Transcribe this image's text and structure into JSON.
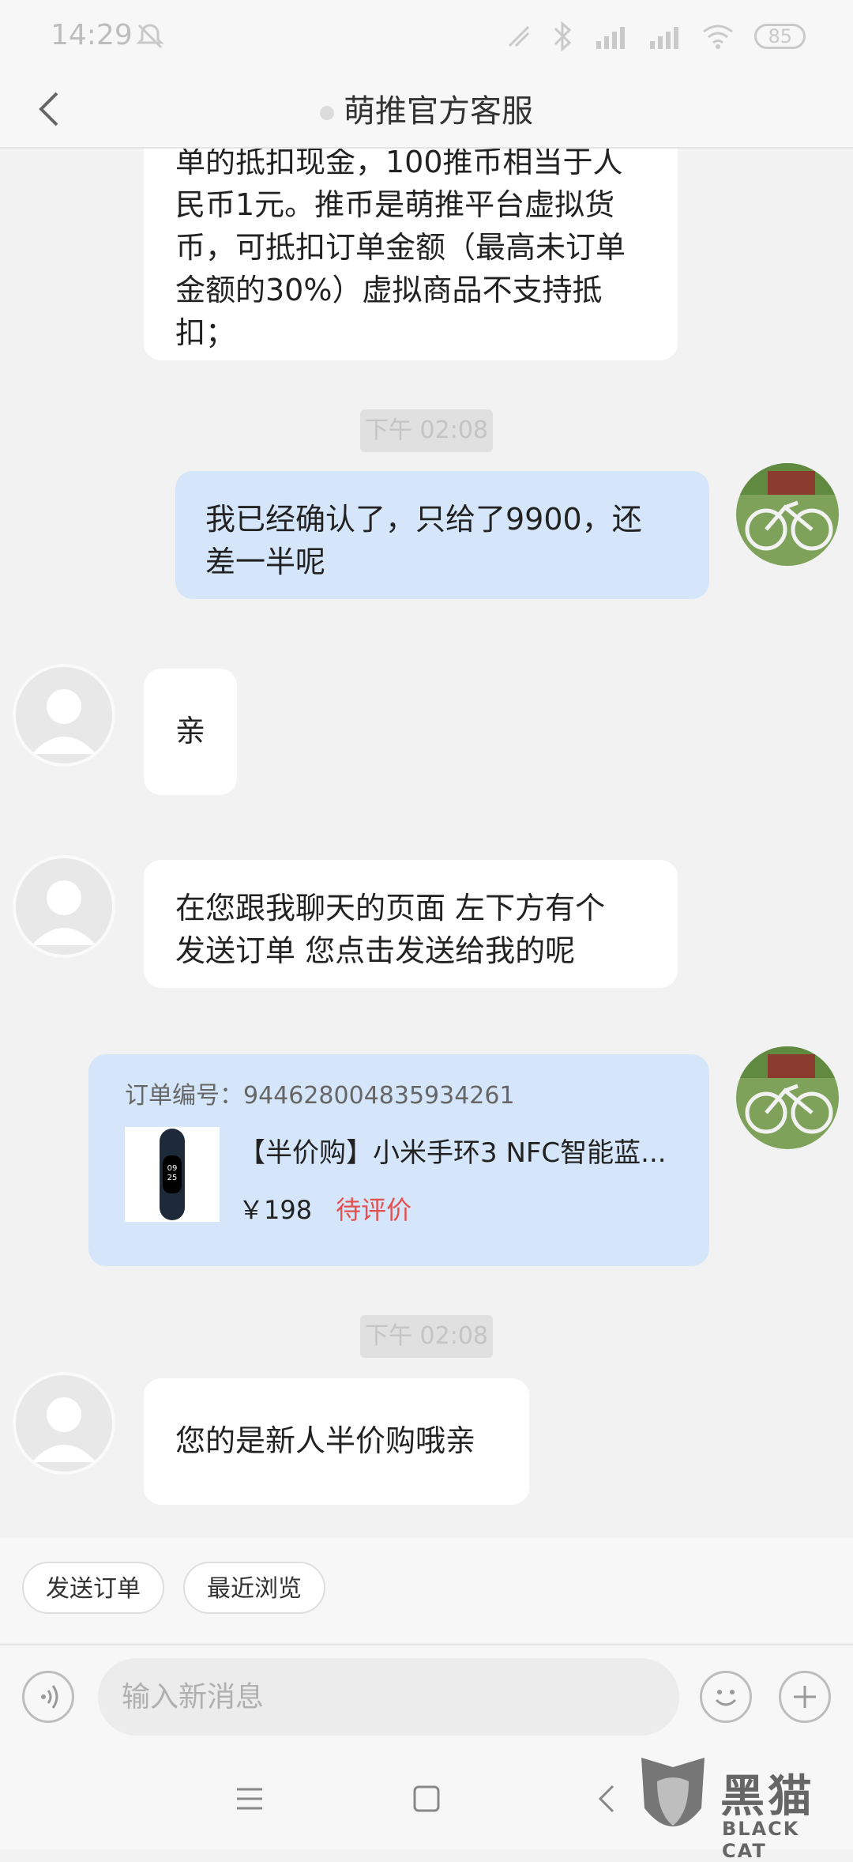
{
  "status": {
    "time": "14:29",
    "battery": "85"
  },
  "header": {
    "title": "萌推官方客服"
  },
  "messages": {
    "m1_lines": [
      "单的抵扣现金，100推币相当于人",
      "民币1元。推币是萌推平台虚拟货",
      "币，可抵扣订单金额（最高未订单",
      "金额的30%）虚拟商品不支持抵",
      "扣；"
    ],
    "ts1": "下午 02:08",
    "m2_lines": [
      "我已经确认了，只给了9900，还",
      "差一半呢"
    ],
    "m3": "亲",
    "m4_lines": [
      "在您跟我聊天的页面 左下方有个",
      "发送订单 您点击发送给我的呢"
    ],
    "order": {
      "id_label": "订单编号：",
      "id": "944628004835934261",
      "title": "【半价购】小米手环3 NFC智能蓝...",
      "price": "￥198",
      "status": "待评价"
    },
    "ts2": "下午 02:08",
    "m5": "您的是新人半价购哦亲"
  },
  "quick": {
    "send_order": "发送订单",
    "recent": "最近浏览"
  },
  "input": {
    "placeholder": "输入新消息"
  },
  "watermark": {
    "cn": "黑猫",
    "en": "BLACK CAT"
  },
  "colors": {
    "bubble_right": "#d5e6fb",
    "bubble_left": "#ffffff",
    "status_red": "#e4504f"
  }
}
